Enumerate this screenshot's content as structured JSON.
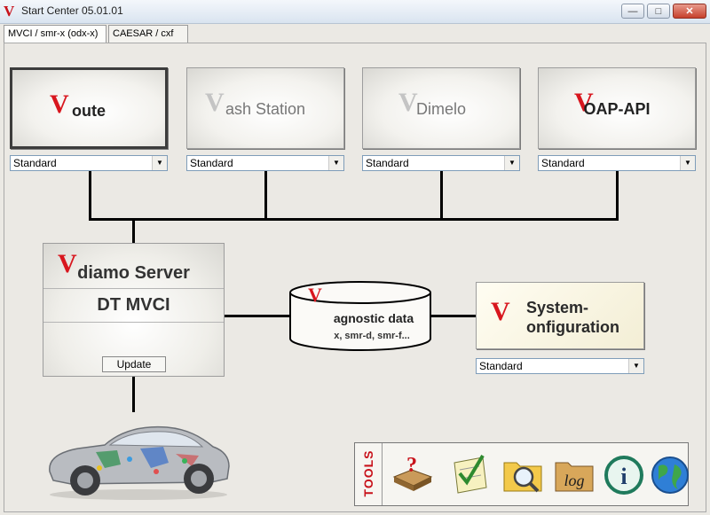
{
  "window": {
    "title": "Start Center 05.01.01",
    "logo_letter": "V",
    "controls": {
      "minimize": "—",
      "maximize": "□",
      "close": "✕"
    }
  },
  "tabs": [
    {
      "label": "MVCI / smr-x (odx-x)",
      "active": true
    },
    {
      "label": "CAESAR / cxf",
      "active": false
    }
  ],
  "tools": [
    {
      "label": "oute",
      "dropdown": "Standard"
    },
    {
      "label": "ash Station",
      "dropdown": "Standard"
    },
    {
      "label": "Dimelo",
      "dropdown": "Standard"
    },
    {
      "label": "OAP-API",
      "dropdown": "Standard"
    }
  ],
  "server": {
    "title": "diamo Server",
    "subtitle": "DT  MVCI",
    "update_label": "Update"
  },
  "diagnostic_data": {
    "title": "agnostic data",
    "formats": "x, smr-d, smr-f..."
  },
  "system_configuration": {
    "line1": "System-",
    "line2": "onfiguration",
    "dropdown": "Standard"
  },
  "tools_bar": {
    "label": "TOOLS",
    "icons": [
      "help-book-icon",
      "checklist-icon",
      "folder-search-icon",
      "log-folder-icon",
      "info-icon",
      "globe-icon"
    ],
    "log_text": "log",
    "info_glyph": "i"
  },
  "colors": {
    "brand_red": "#d8161e",
    "window_bg": "#ebe9e4"
  }
}
